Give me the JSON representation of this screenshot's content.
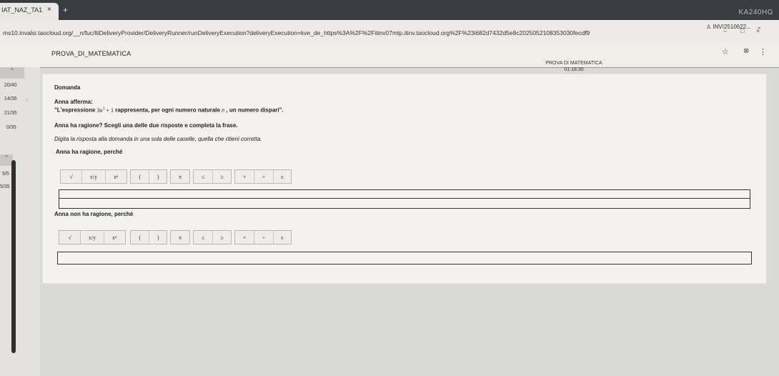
{
  "browser": {
    "tab_title": "IAT_NAZ_TA1",
    "tab_close": "×",
    "new_tab": "+",
    "top_right": "KA240HG",
    "url": "ms10.invalsi.taocloud.org/__n/fuc/ltiDeliveryProvider/DeliveryRunner/runDeliveryExecution?deliveryExecution=kve_de_https%3A%2F%2Fitinv07mtp.itinv.taocloud.org%2F%23i682d7432d5e8c2025052108353030fecdf9",
    "minimize": "–",
    "restore": "□",
    "close": "×"
  },
  "app": {
    "title": "PROVA_DI_MATEMATICA",
    "center_title": "PROVA DI MATEMATICA",
    "timer": "01:18:30",
    "user": "INVI2510622...",
    "star_icon": "☆",
    "extension_icon": "⊗",
    "menu_icon": "⋮"
  },
  "nav": {
    "collapse": "^",
    "items": [
      "20/40",
      "14/35",
      "21/35",
      "0/35"
    ],
    "section2_collapse": "^",
    "section2_items": [
      "5/5",
      "5/35"
    ],
    "back_chevron": "‹"
  },
  "question": {
    "heading": "Domanda",
    "intro": "Anna afferma:",
    "quote_start": "\"L'espressione ",
    "expr_base": "3n",
    "expr_exp": "3",
    "expr_plus": " + 1",
    "quote_mid": " rappresenta, per ogni numero naturale ",
    "quote_var": "n",
    "quote_end": " , un numero dispari\".",
    "prompt": "Anna ha ragione? Scegli una delle due risposte e completa la frase.",
    "instruction": "Digita la risposta alla domanda in una sola delle caselle, quella che ritieni corretta.",
    "option1": "Anna ha ragione, perché",
    "option2": "Anna non ha ragione, perché"
  },
  "toolbar": {
    "sqrt": "√",
    "frac": "x/y",
    "pow": "xⁿ",
    "paren_open": "(",
    "paren_close": ")",
    "pi": "π",
    "le": "≤",
    "ge": "≥",
    "times": "×",
    "div": "÷",
    "pm": "±"
  }
}
